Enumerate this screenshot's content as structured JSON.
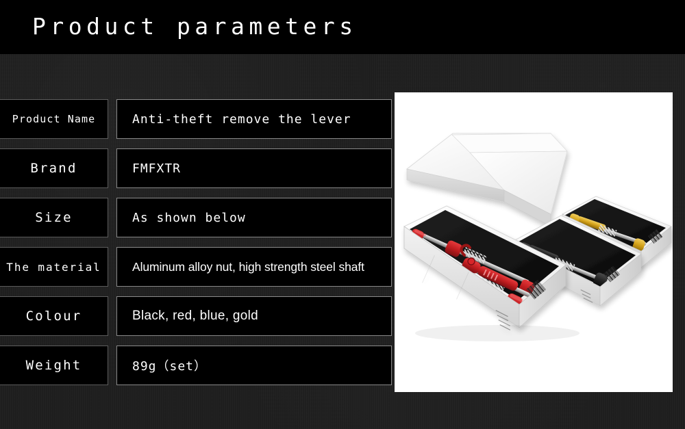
{
  "header": {
    "title": "Product parameters"
  },
  "spec_table": {
    "rows": [
      {
        "label": "Product Name",
        "value": "Anti-theft remove the lever"
      },
      {
        "label": "Brand",
        "value": "FMFXTR"
      },
      {
        "label": "Size",
        "value": "As shown below"
      },
      {
        "label": "The material",
        "value": "Aluminum alloy nut, high strength steel shaft"
      },
      {
        "label": "Colour",
        "value": "Black, red, blue, gold"
      },
      {
        "label": "Weight",
        "value": "89g（set）"
      }
    ]
  },
  "product_photo": {
    "alt": "Three white retail boxes containing bicycle quick-release skewer sets in red, black and gold, with a white box lid resting behind them",
    "background": "#ffffff",
    "box_colors": {
      "lid": "#f4f4f4",
      "box_outer": "#fbfbfb",
      "box_side": "#dcdcdc",
      "foam": "#141414"
    },
    "skewer_sets": [
      {
        "name": "red-set",
        "color": "#c01f22"
      },
      {
        "name": "black-set",
        "color": "#1a1a1a"
      },
      {
        "name": "gold-set",
        "color": "#d3a018"
      }
    ]
  },
  "colors": {
    "page_background": "#1d1d1d",
    "header_background": "#000000",
    "cell_background": "#000000",
    "label_border": "#5d5d5d",
    "value_border": "#8a8a8a",
    "text": "#ffffff"
  }
}
